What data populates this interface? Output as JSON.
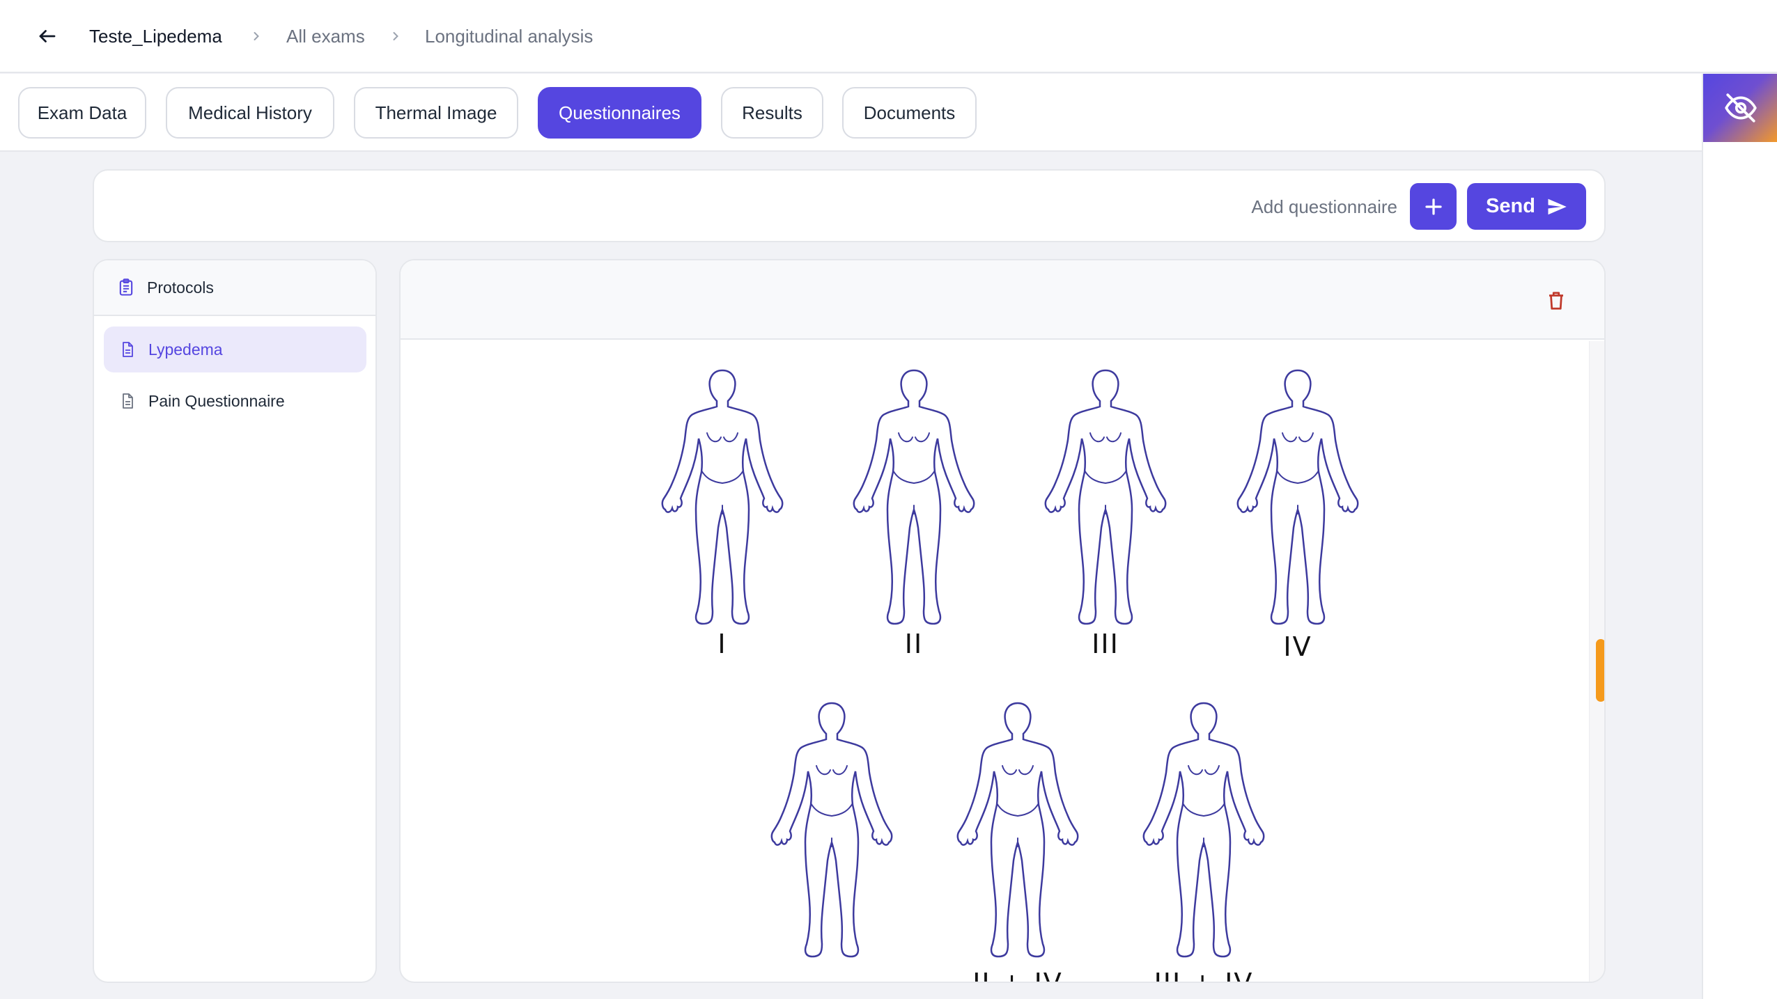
{
  "header": {
    "back_icon": "arrow-left-icon",
    "breadcrumbs": [
      "Teste_Lipedema",
      "All exams",
      "Longitudinal analysis"
    ]
  },
  "tabs": [
    {
      "label": "Exam Data",
      "active": false
    },
    {
      "label": "Medical History",
      "active": false
    },
    {
      "label": "Thermal Image",
      "active": false
    },
    {
      "label": "Questionnaires",
      "active": true
    },
    {
      "label": "Results",
      "active": false
    },
    {
      "label": "Documents",
      "active": false
    }
  ],
  "actions": {
    "add_questionnaire_label": "Add questionnaire",
    "send_label": "Send"
  },
  "protocols": {
    "title": "Protocols",
    "items": [
      {
        "label": "Lypedema",
        "selected": true
      },
      {
        "label": "Pain Questionnaire",
        "selected": false
      }
    ]
  },
  "questionnaire": {
    "figures": [
      {
        "label": "I"
      },
      {
        "label": "II"
      },
      {
        "label": "III"
      },
      {
        "label": "IV"
      },
      {
        "label": ""
      },
      {
        "label": "II + IV"
      },
      {
        "label": "III + IV"
      }
    ]
  },
  "colors": {
    "accent": "#5546e0",
    "highlight": "#f59a1c",
    "outline": "#3d3a9e",
    "danger": "#c0392b"
  }
}
